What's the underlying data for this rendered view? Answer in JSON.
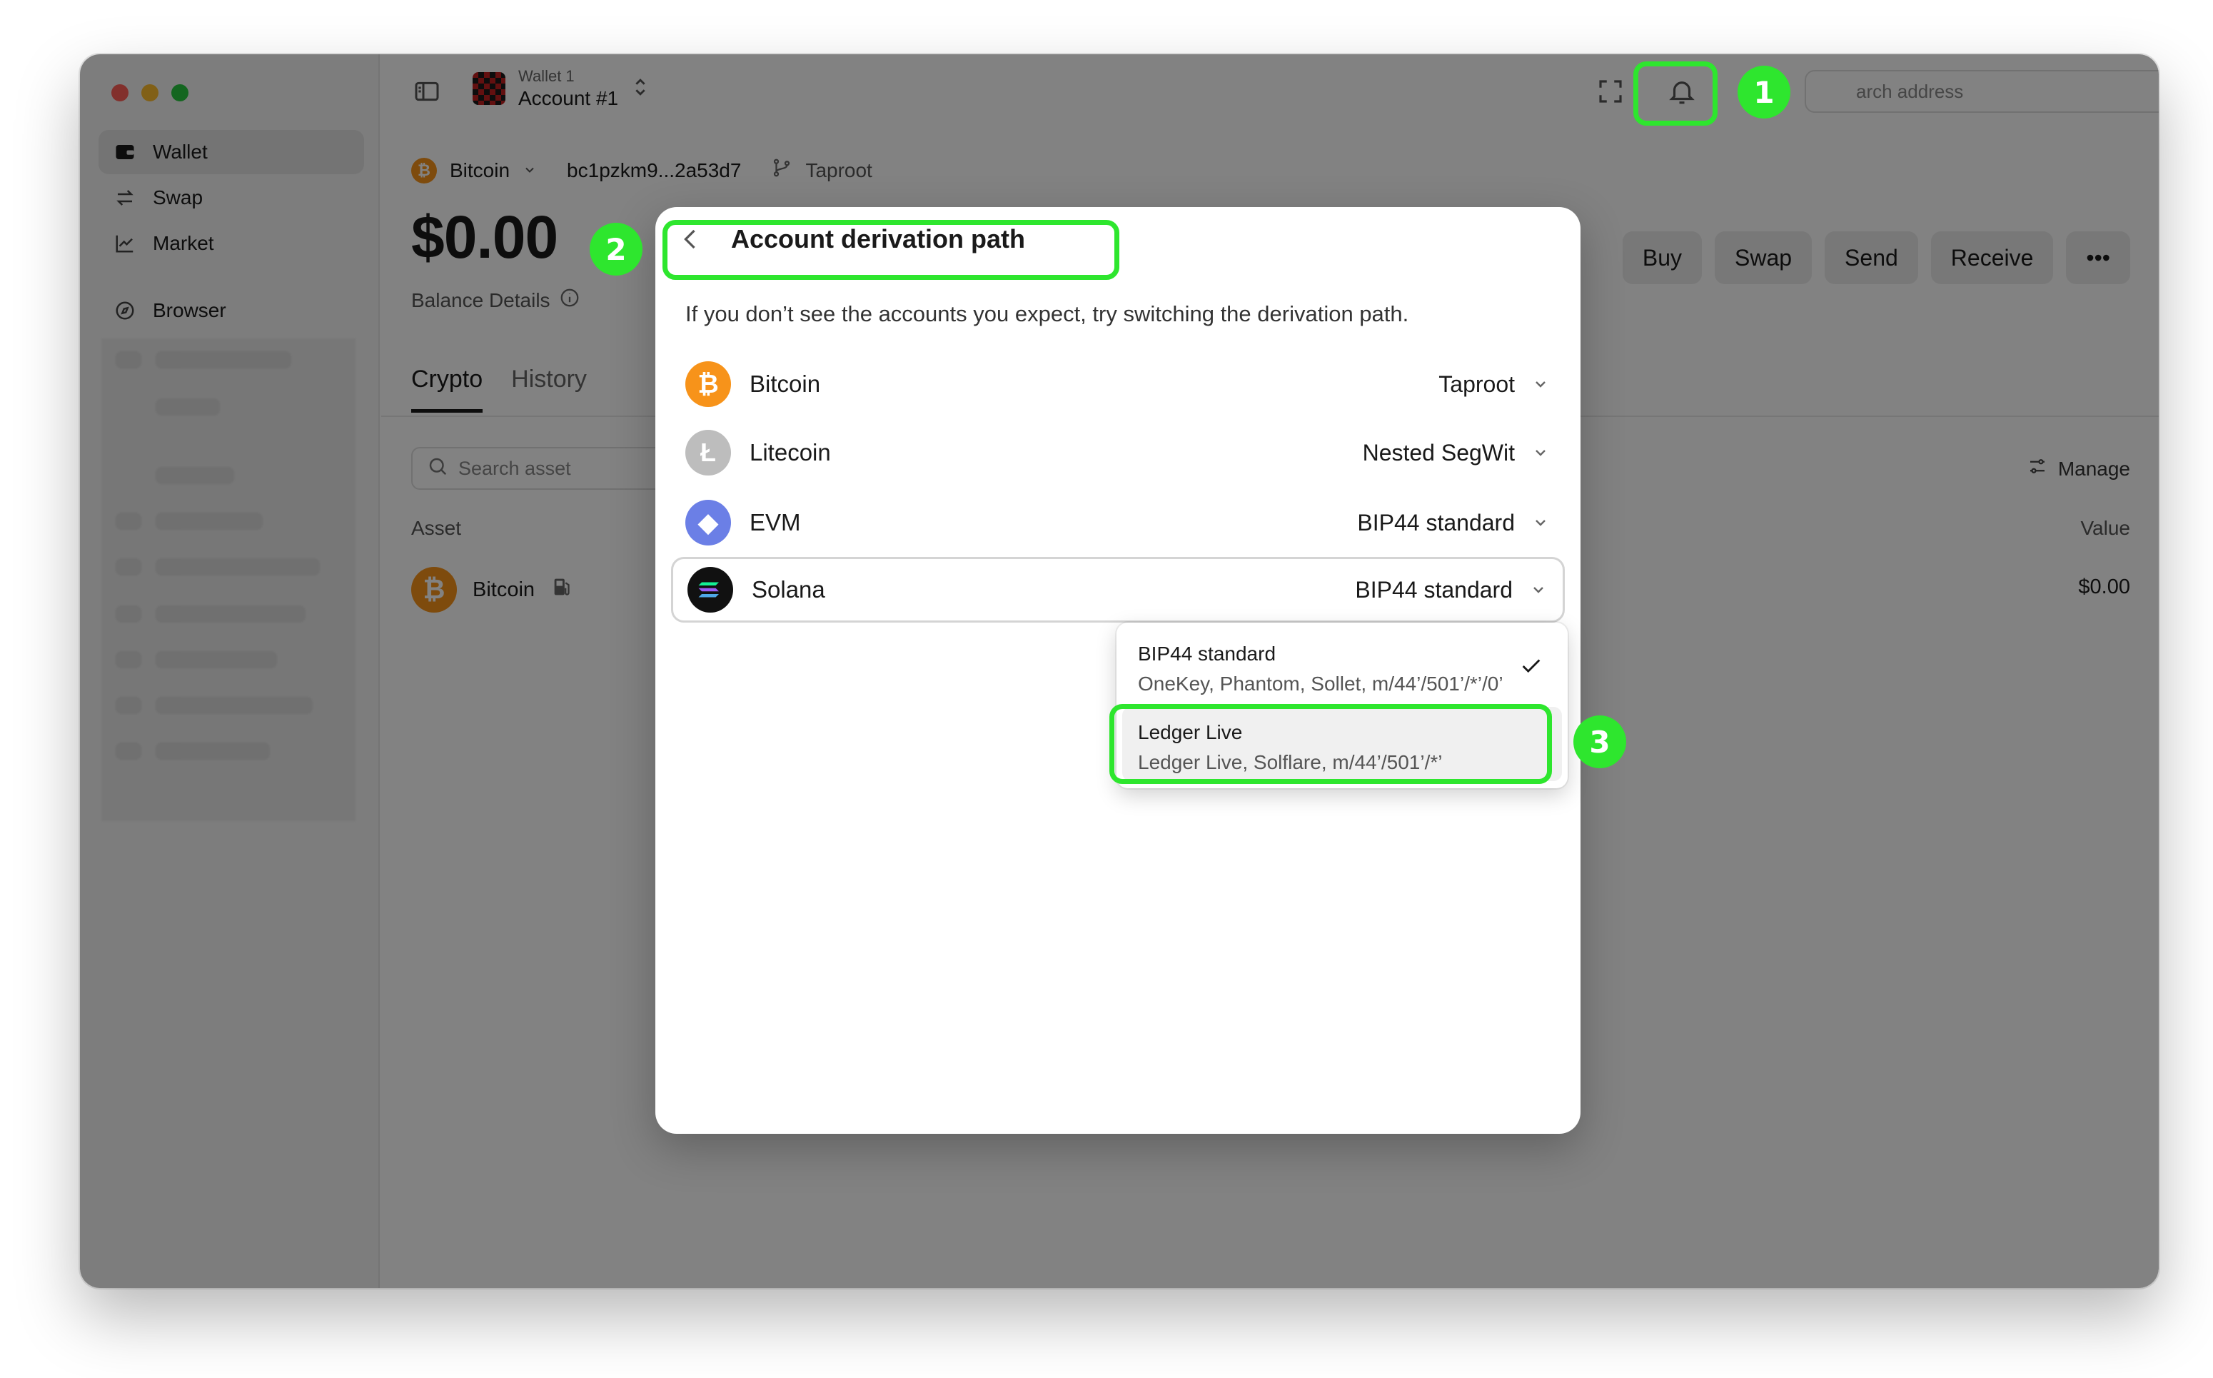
{
  "sidebar": {
    "items": [
      {
        "label": "Wallet",
        "icon": "wallet-icon"
      },
      {
        "label": "Swap",
        "icon": "swap-icon"
      },
      {
        "label": "Market",
        "icon": "market-chart-icon"
      },
      {
        "label": "Browser",
        "icon": "compass-icon"
      }
    ]
  },
  "header": {
    "wallet_label": "Wallet 1",
    "account_label": "Account #1",
    "search_placeholder": "Search address",
    "search_visible": "arch address"
  },
  "account": {
    "network": "Bitcoin",
    "address": "bc1pzkm9...2a53d7",
    "address_type": "Taproot",
    "balance": "$0.00",
    "balance_details": "Balance Details"
  },
  "actions": [
    "Buy",
    "Swap",
    "Send",
    "Receive",
    "•••"
  ],
  "tabs": [
    "Crypto",
    "History"
  ],
  "asset_search_placeholder": "Search asset",
  "manage_label": "Manage",
  "table": {
    "col_asset": "Asset",
    "col_value": "Value",
    "rows": [
      {
        "name": "Bitcoin",
        "value": "$0.00"
      }
    ]
  },
  "modal": {
    "title": "Account derivation path",
    "description": "If you don’t see the accounts you expect, try switching the derivation path.",
    "chains": [
      {
        "name": "Bitcoin",
        "path": "Taproot",
        "color": "#f7931a",
        "glyph": "₿"
      },
      {
        "name": "Litecoin",
        "path": "Nested SegWit",
        "color": "#bdbdbd",
        "glyph": "Ł"
      },
      {
        "name": "EVM",
        "path": "BIP44 standard",
        "color": "#6b7fe6",
        "glyph": "◆"
      },
      {
        "name": "Solana",
        "path": "BIP44 standard",
        "color": "#111111",
        "glyph": "≡"
      }
    ],
    "dropdown": [
      {
        "title": "BIP44 standard",
        "subtitle": "OneKey, Phantom, Sollet, m/44’/501’/*’/0’",
        "selected": true
      },
      {
        "title": "Ledger Live",
        "subtitle": "Ledger Live, Solflare, m/44’/501’/*’",
        "selected": false
      }
    ]
  },
  "annotations": [
    "1",
    "2",
    "3"
  ],
  "colors": {
    "highlight": "#2ee62e",
    "bitcoin": "#f7931a"
  }
}
